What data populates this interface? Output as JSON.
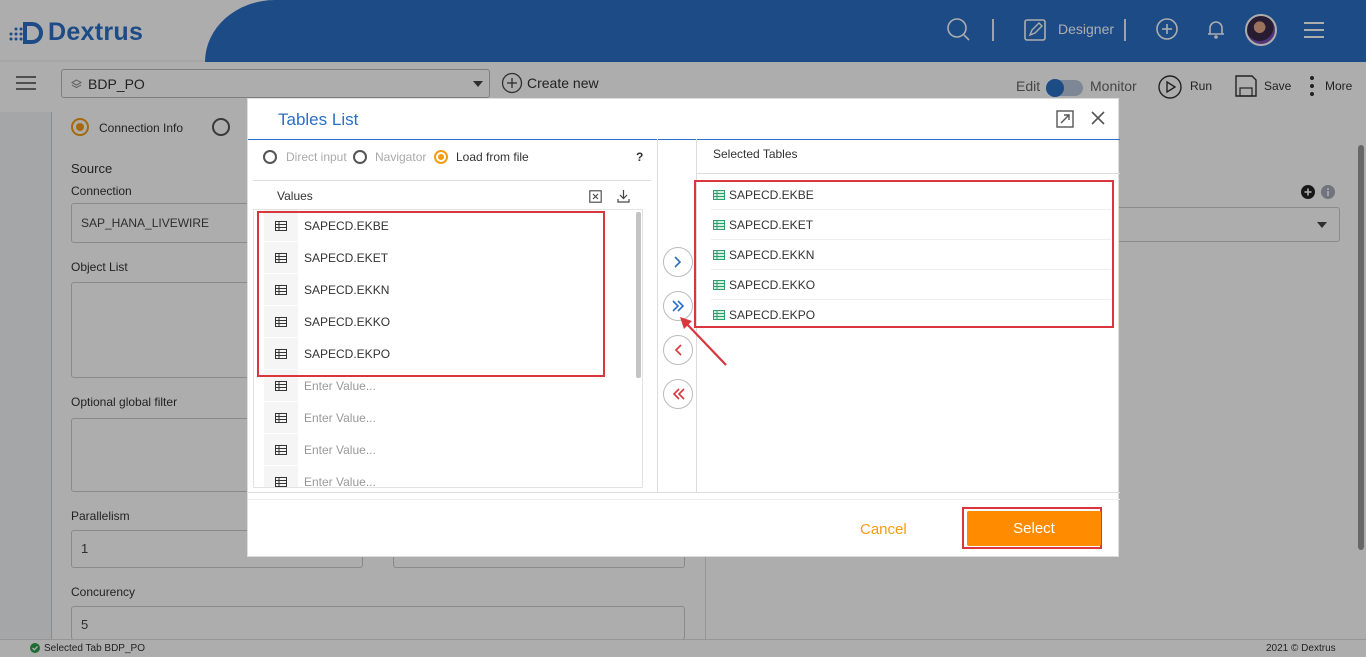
{
  "app": {
    "name": "Dextrus"
  },
  "header": {
    "designer_label": "Designer"
  },
  "toolbar": {
    "pipeline_value": "BDP_PO",
    "create_new": "Create new",
    "edit_label": "Edit",
    "monitor_label": "Monitor",
    "run_label": "Run",
    "save_label": "Save",
    "more_label": "More"
  },
  "steps": {
    "connection_info": "Connection Info"
  },
  "form": {
    "source_heading": "Source",
    "connection_label": "Connection",
    "connection_value": "SAP_HANA_LIVEWIRE",
    "object_list_label": "Object List",
    "global_filter_label": "Optional global filter",
    "parallelism_label": "Parallelism",
    "parallelism_value": "1",
    "concurrency_label": "Concurency",
    "concurrency_value": "5"
  },
  "modal": {
    "title": "Tables List",
    "modes": [
      {
        "label": "Direct input",
        "selected": false
      },
      {
        "label": "Navigator",
        "selected": false
      },
      {
        "label": "Load from file",
        "selected": true
      }
    ],
    "help": "?",
    "values_header": "Values",
    "values": [
      "SAPECD.EKBE",
      "SAPECD.EKET",
      "SAPECD.EKKN",
      "SAPECD.EKKO",
      "SAPECD.EKPO"
    ],
    "placeholders": [
      "Enter Value...",
      "Enter Value...",
      "Enter Value...",
      "Enter Value..."
    ],
    "selected_header": "Selected Tables",
    "selected": [
      "SAPECD.EKBE",
      "SAPECD.EKET",
      "SAPECD.EKKN",
      "SAPECD.EKKO",
      "SAPECD.EKPO"
    ],
    "cancel_label": "Cancel",
    "select_label": "Select"
  },
  "status": {
    "left": "Selected Tab BDP_PO",
    "right": "2021 © Dextrus"
  },
  "colors": {
    "brand": "#2b6fc6",
    "accent": "#ff8c00",
    "highlight": "#d9363e"
  }
}
